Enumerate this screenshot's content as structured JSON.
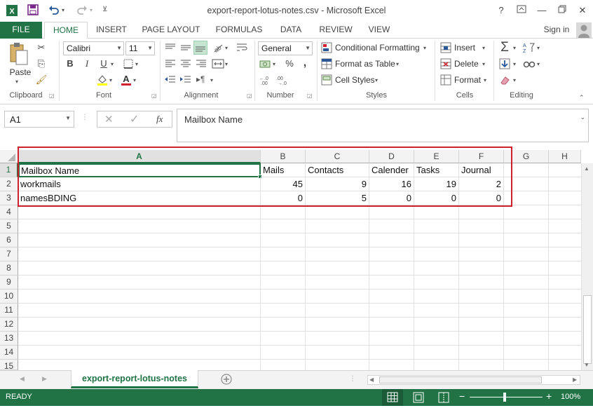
{
  "window": {
    "title": "export-report-lotus-notes.csv - Microsoft Excel",
    "help": "?",
    "minimize": "—",
    "close": "✕"
  },
  "tabs": [
    "FILE",
    "HOME",
    "INSERT",
    "PAGE LAYOUT",
    "FORMULAS",
    "DATA",
    "REVIEW",
    "VIEW"
  ],
  "signin": "Sign in",
  "ribbon": {
    "clipboard": {
      "paste": "Paste",
      "label": "Clipboard"
    },
    "font": {
      "name": "Calibri",
      "size": "11",
      "label": "Font",
      "bold": "B",
      "italic": "I",
      "underline": "U"
    },
    "alignment": {
      "label": "Alignment"
    },
    "number": {
      "format": "General",
      "label": "Number",
      "percent": "%",
      "comma": ","
    },
    "styles": {
      "conditional": "Conditional Formatting",
      "format_table": "Format as Table",
      "cell_styles": "Cell Styles",
      "label": "Styles"
    },
    "cells": {
      "insert": "Insert",
      "delete": "Delete",
      "format": "Format",
      "label": "Cells"
    },
    "editing": {
      "label": "Editing"
    }
  },
  "formula_bar": {
    "name_box": "A1",
    "fx": "fx",
    "content": "Mailbox Name"
  },
  "columns": [
    "A",
    "B",
    "C",
    "D",
    "E",
    "F",
    "G",
    "H"
  ],
  "rows": [
    "1",
    "2",
    "3",
    "4",
    "5",
    "6",
    "7",
    "8",
    "9",
    "10",
    "11",
    "12",
    "13",
    "14",
    "15"
  ],
  "cells": {
    "r1": [
      "Mailbox Name",
      "Mails",
      "Contacts",
      "Calender",
      "Tasks",
      "Journal"
    ],
    "r2": [
      "workmails",
      "45",
      "9",
      "16",
      "19",
      "2"
    ],
    "r3": [
      "namesBDING",
      "0",
      "5",
      "0",
      "0",
      "0"
    ]
  },
  "sheet_tab": "export-report-lotus-notes",
  "status": {
    "ready": "READY",
    "zoom": "100%"
  },
  "colors": {
    "accent": "#217346",
    "highlight": "#d0202e"
  }
}
